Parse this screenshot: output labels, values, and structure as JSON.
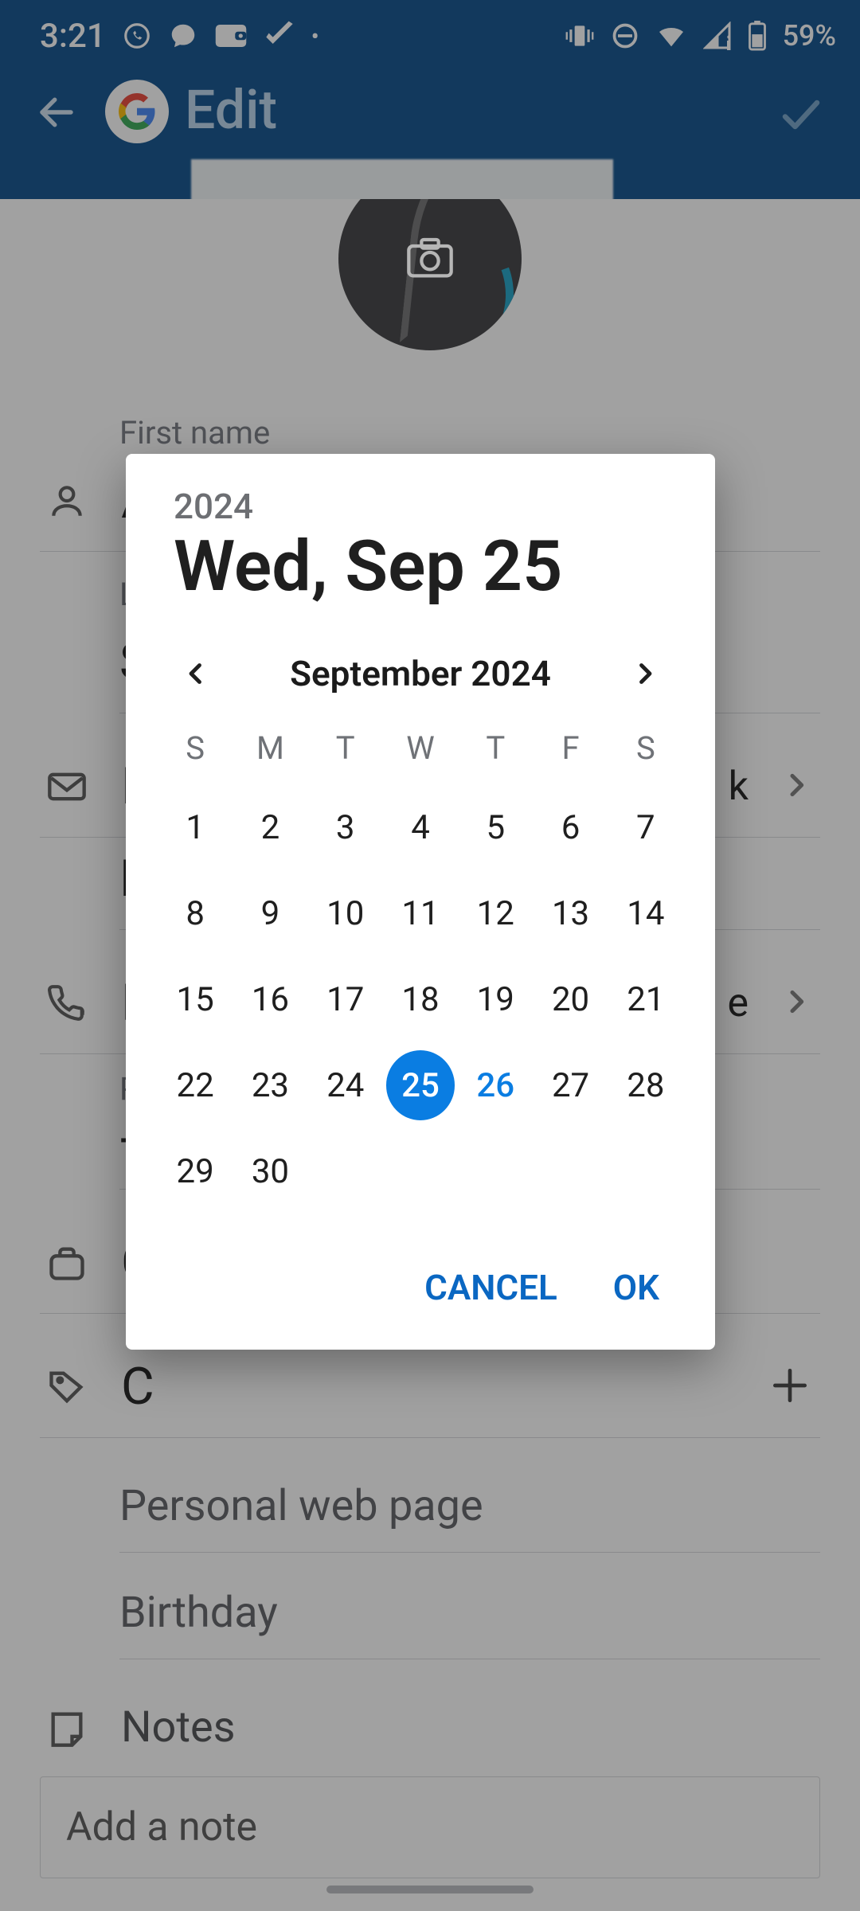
{
  "status": {
    "time": "3:21",
    "battery_text": "59%"
  },
  "header": {
    "title": "Edit"
  },
  "form": {
    "first_name_label": "First name",
    "first_name_initial": "A",
    "last_name_label_initial": "L",
    "last_name_initial": "S",
    "email_initial": "E",
    "email_trail": "k",
    "email2_initial": "E",
    "phone_initial": "P",
    "phone_trail": "e",
    "phone2_initial": "P",
    "phone2_value_prefix": "+",
    "company_initial": "C",
    "group_initial": "C",
    "webpage_label": "Personal web page",
    "birthday_label": "Birthday",
    "notes_label": "Notes",
    "add_note_placeholder": "Add a note"
  },
  "dialog": {
    "year": "2024",
    "date_display": "Wed, Sep 25",
    "month_label": "September 2024",
    "weekdays": [
      "S",
      "M",
      "T",
      "W",
      "T",
      "F",
      "S"
    ],
    "weeks": [
      [
        1,
        2,
        3,
        4,
        5,
        6,
        7
      ],
      [
        8,
        9,
        10,
        11,
        12,
        13,
        14
      ],
      [
        15,
        16,
        17,
        18,
        19,
        20,
        21
      ],
      [
        22,
        23,
        24,
        25,
        26,
        27,
        28
      ],
      [
        29,
        30,
        null,
        null,
        null,
        null,
        null
      ]
    ],
    "selected_day": 25,
    "today_day": 26,
    "cancel_label": "CANCEL",
    "ok_label": "OK"
  }
}
